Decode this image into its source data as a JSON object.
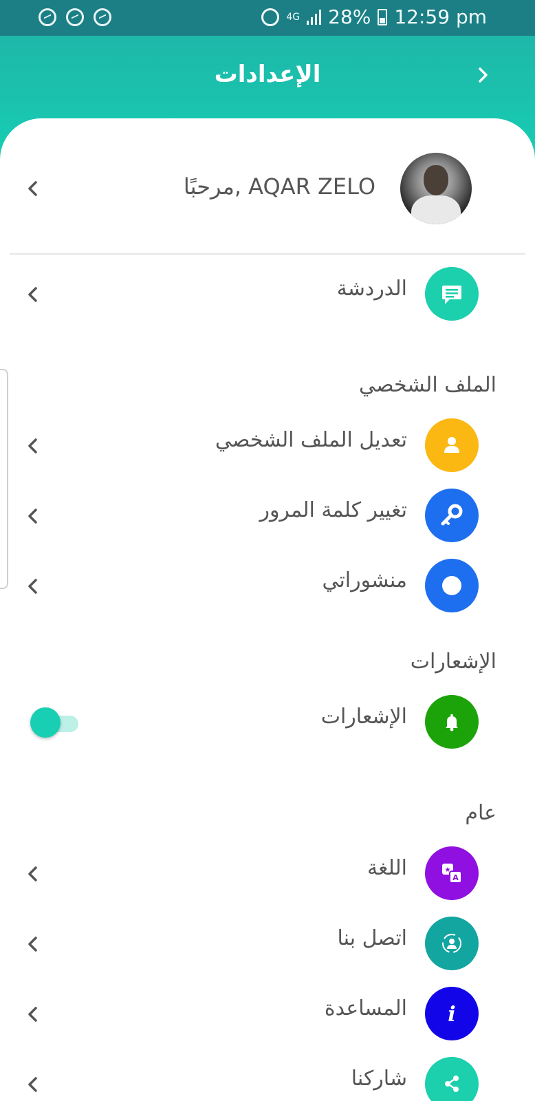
{
  "status_bar": {
    "network": "4G",
    "battery": "28%",
    "time": "12:59 pm"
  },
  "header": {
    "title": "الإعدادات",
    "back_icon": "chevron-right-icon"
  },
  "profile": {
    "greeting": "مرحبًا, AQAR ZELO"
  },
  "chat": {
    "label": "الدردشة",
    "icon": "chat-icon",
    "color": "#1ccfad"
  },
  "sections": {
    "profile_title": "الملف الشخصي",
    "notifications_title": "الإشعارات",
    "general_title": "عام"
  },
  "profile_items": [
    {
      "label": "تعديل الملف الشخصي",
      "icon": "user-icon",
      "color": "#fbb812"
    },
    {
      "label": "تغيير كلمة المرور",
      "icon": "key-icon",
      "color": "#1e6ff0"
    },
    {
      "label": "منشوراتي",
      "icon": "circle-icon",
      "color": "#1e6ff0"
    }
  ],
  "notifications": {
    "label": "الإشعارات",
    "icon": "bell-icon",
    "color": "#1da30a",
    "enabled": true
  },
  "general_items": [
    {
      "label": "اللغة",
      "icon": "translate-icon",
      "color": "#8f10e0"
    },
    {
      "label": "اتصل بنا",
      "icon": "support-agent-icon",
      "color": "#13a5a0"
    },
    {
      "label": "المساعدة",
      "icon": "info-icon",
      "color": "#1206e8"
    },
    {
      "label": "شاركنا",
      "icon": "share-icon",
      "color": "#1ccfad"
    }
  ]
}
